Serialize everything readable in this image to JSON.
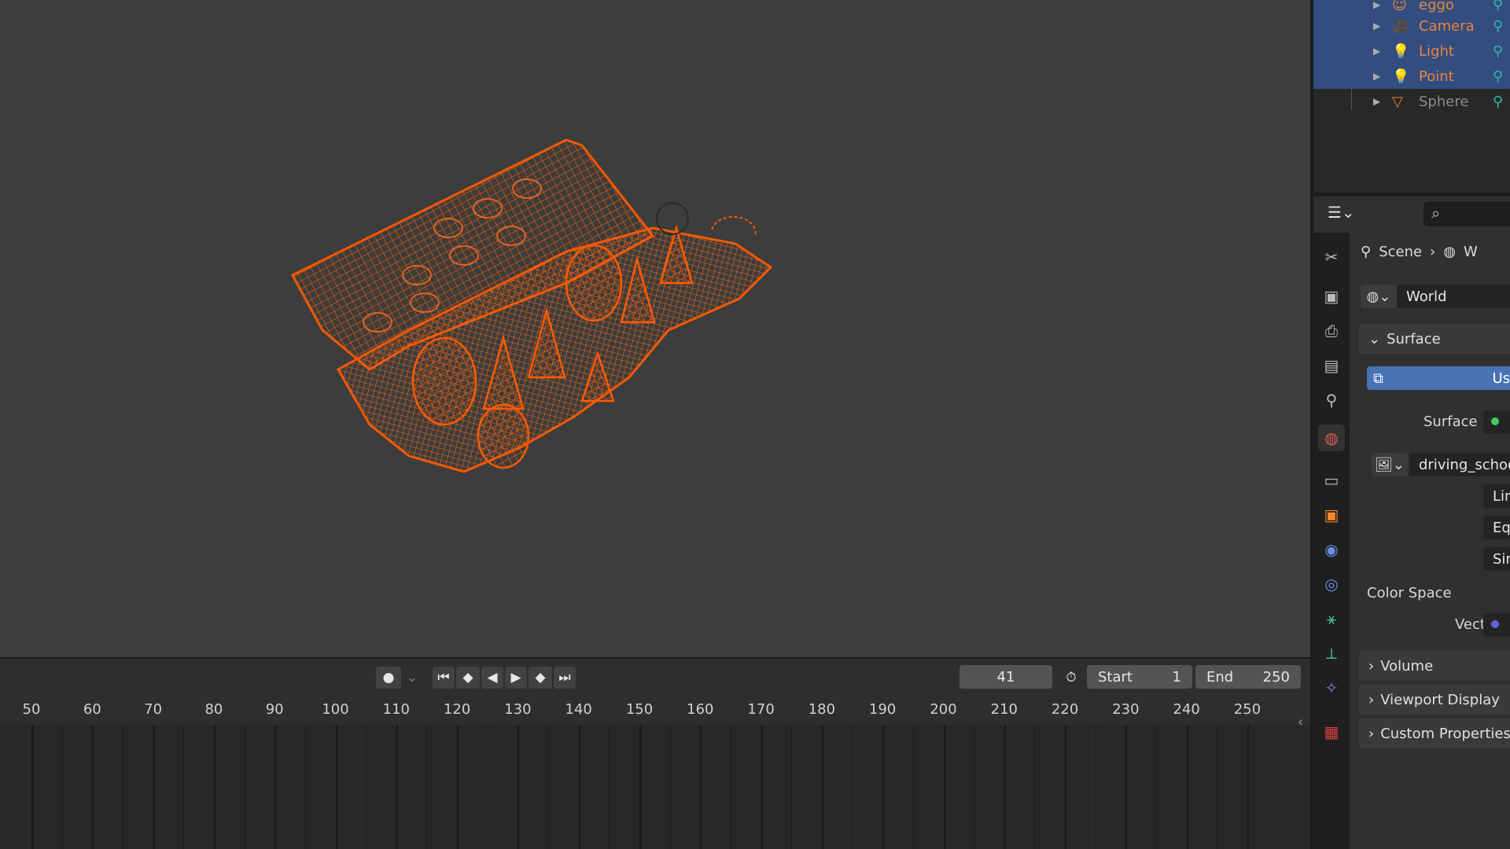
{
  "outliner": {
    "items": [
      {
        "label": "eggo",
        "color": "#e8843a",
        "selected": true
      },
      {
        "label": "Camera",
        "color": "#e8843a",
        "selected": true
      },
      {
        "label": "Light",
        "color": "#e8843a",
        "selected": true
      },
      {
        "label": "Point",
        "color": "#e8843a",
        "selected": true
      },
      {
        "label": "Sphere",
        "color": "#8a8a8a",
        "selected": false
      }
    ]
  },
  "properties": {
    "breadcrumb": {
      "scene": "Scene",
      "world": "W"
    },
    "world_name": "World",
    "surface_panel": "Surface",
    "use_nodes_label": "Us",
    "surface_label": "Surface",
    "image_name": "driving_school_",
    "option_1": "Lin",
    "option_2": "Equ",
    "option_3": "Sin",
    "color_space_label": "Color Space",
    "vector_label": "Vector",
    "volume_panel": "Volume",
    "viewport_display_panel": "Viewport Display",
    "custom_properties_panel": "Custom Properties"
  },
  "timeline": {
    "current_frame": "41",
    "start_label": "Start",
    "start_value": "1",
    "end_label": "End",
    "end_value": "250",
    "ticks": [
      "50",
      "60",
      "70",
      "80",
      "90",
      "100",
      "110",
      "120",
      "130",
      "140",
      "150",
      "160",
      "170",
      "180",
      "190",
      "200",
      "210",
      "220",
      "230",
      "240",
      "250"
    ]
  },
  "colors": {
    "wireframe": "#ff5a00",
    "selection": "#334d80",
    "accent_blue": "#4772b3"
  }
}
